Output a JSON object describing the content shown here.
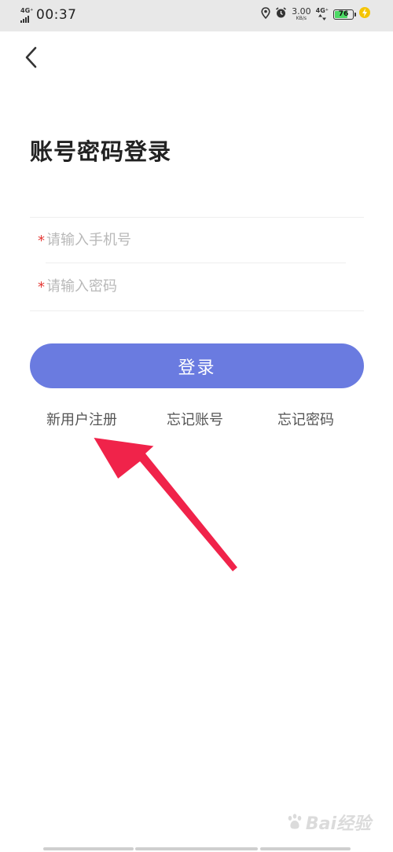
{
  "status_bar": {
    "network_left": "4G⁺",
    "time": "00:37",
    "speed_value": "3.00",
    "speed_unit": "KB/s",
    "network_right": "4G⁺",
    "battery_level": "76",
    "battery_fill_percent": 76,
    "battery_color": "#4cd964"
  },
  "page": {
    "title": "账号密码登录"
  },
  "form": {
    "required_marker": "*",
    "phone_placeholder": "请输入手机号",
    "password_placeholder": "请输入密码",
    "login_label": "登录"
  },
  "links": {
    "register": "新用户注册",
    "forgot_account": "忘记账号",
    "forgot_password": "忘记密码"
  },
  "theme": {
    "accent": "#6a7be0",
    "required_color": "#e53935",
    "annotation_arrow_color": "#f0234a"
  },
  "watermark": {
    "text": "Bai经验"
  }
}
